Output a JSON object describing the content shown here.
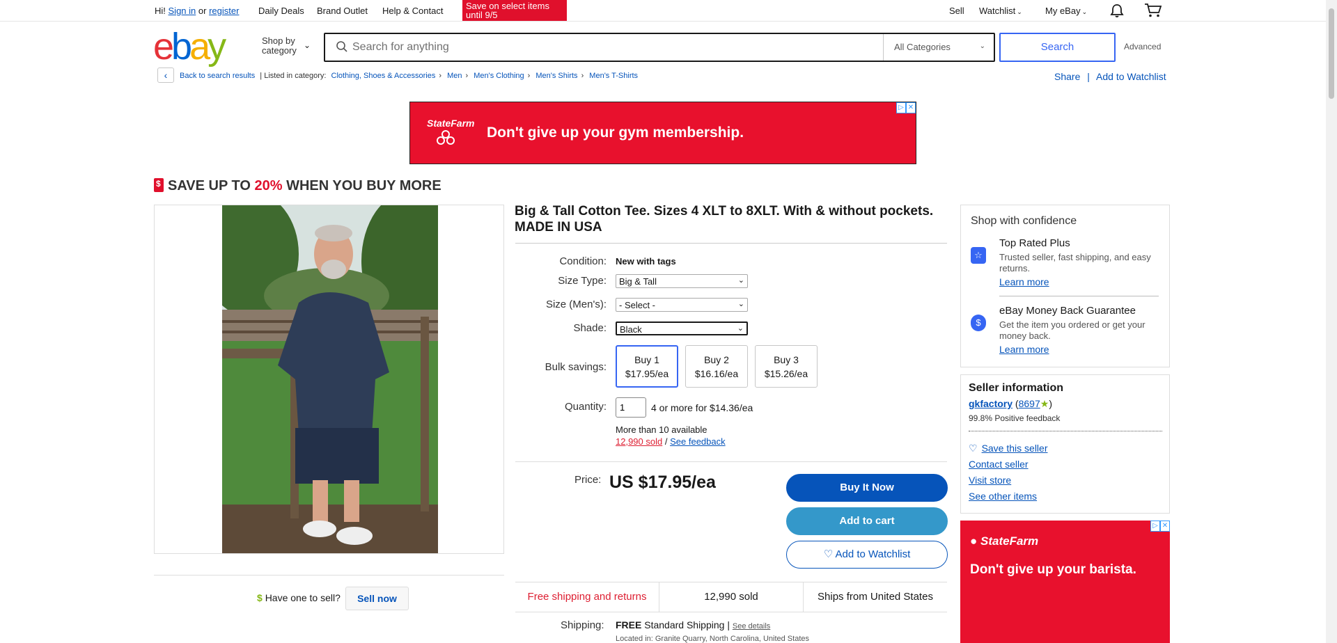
{
  "topbar": {
    "greeting": "Hi!",
    "sign_in": "Sign in",
    "or": "or",
    "register": "register",
    "daily_deals": "Daily Deals",
    "brand_outlet": "Brand Outlet",
    "help_contact": "Help & Contact",
    "promo": "Save on select items until 9/5",
    "sell": "Sell",
    "watchlist": "Watchlist",
    "my_ebay": "My eBay",
    "notification_icon": "bell-icon",
    "cart_icon": "cart-icon"
  },
  "header": {
    "logo": [
      "e",
      "b",
      "a",
      "y"
    ],
    "shop_by_category": "Shop by category",
    "search_placeholder": "Search for anything",
    "category_select": "All Categories",
    "search_button": "Search",
    "advanced": "Advanced"
  },
  "breadcrumb": {
    "back": "Back to search results",
    "listed_in": "| Listed in category:",
    "items": [
      "Clothing, Shoes & Accessories",
      "Men",
      "Men's Clothing",
      "Men's Shirts",
      "Men's T-Shirts"
    ],
    "share": "Share",
    "add_to_watchlist": "Add to Watchlist"
  },
  "ads": {
    "top": {
      "brand": "StateFarm",
      "message": "Don't give up your gym membership."
    },
    "side": {
      "brand": "StateFarm",
      "message": "Don't give up your barista."
    }
  },
  "save_banner": {
    "prefix": "SAVE UP TO ",
    "percent": "20%",
    "suffix": " WHEN YOU BUY MORE"
  },
  "item": {
    "title": "Big & Tall Cotton Tee. Sizes 4 XLT to 8XLT. With & without pockets. MADE IN USA",
    "condition_label": "Condition:",
    "condition": "New with tags",
    "size_type_label": "Size Type:",
    "size_type": "Big & Tall",
    "size_label": "Size (Men's):",
    "size": "- Select -",
    "shade_label": "Shade:",
    "shade": "Black",
    "bulk_label": "Bulk savings:",
    "bulk": [
      {
        "qty": "Buy 1",
        "price": "$17.95/ea"
      },
      {
        "qty": "Buy 2",
        "price": "$16.16/ea"
      },
      {
        "qty": "Buy 3",
        "price": "$15.26/ea"
      }
    ],
    "quantity_label": "Quantity:",
    "quantity": "1",
    "quantity_deal": "4 or more for $14.36/ea",
    "available": "More than 10 available",
    "sold": "12,990 sold",
    "slash": "/",
    "see_feedback": "See feedback",
    "price_label": "Price:",
    "price": "US $17.95/ea",
    "buy_now": "Buy It Now",
    "add_to_cart": "Add to cart",
    "add_to_watchlist": "Add to Watchlist",
    "strip": [
      "Free shipping and returns",
      "12,990 sold",
      "Ships from United States"
    ],
    "shipping_label": "Shipping:",
    "shipping_free": "FREE",
    "shipping_method": "Standard Shipping |",
    "see_details": "See details",
    "location": "Located in: Granite Quarry, North Carolina, United States"
  },
  "sell_row": {
    "question": "Have one to sell?",
    "button": "Sell now"
  },
  "confidence": {
    "title": "Shop with confidence",
    "items": [
      {
        "icon": "star-badge-icon",
        "title": "Top Rated Plus",
        "desc": "Trusted seller, fast shipping, and easy returns.",
        "link": "Learn more"
      },
      {
        "icon": "shield-dollar-icon",
        "title": "eBay Money Back Guarantee",
        "desc": "Get the item you ordered or get your money back.",
        "link": "Learn more"
      }
    ]
  },
  "seller": {
    "title": "Seller information",
    "name": "gkfactory",
    "score": "8697",
    "feedback": "99.8% Positive feedback",
    "save": "Save this seller",
    "contact": "Contact seller",
    "visit": "Visit store",
    "other": "See other items"
  },
  "colors": {
    "accent": "#3665f3",
    "link": "#0654ba",
    "buy_now": "#0654ba",
    "add_to_cart": "#3498ca",
    "ad_red": "#e8112d"
  }
}
